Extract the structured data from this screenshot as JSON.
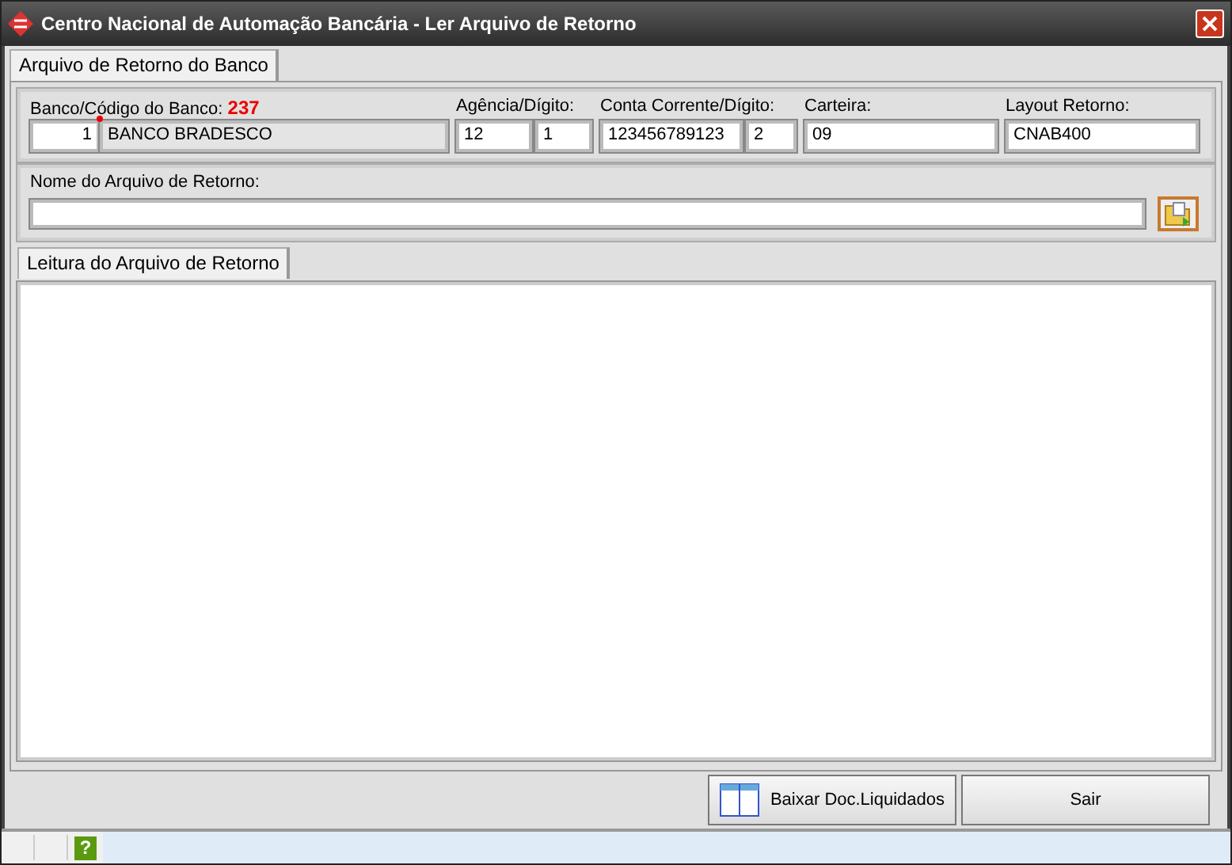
{
  "window": {
    "title": "Centro Nacional de Automação Bancária - Ler Arquivo de Retorno"
  },
  "tabs": [
    {
      "label": "Arquivo de Retorno do Banco",
      "selected": true
    }
  ],
  "bank": {
    "label": "Banco/Código do Banco:",
    "code_label": "237",
    "number": "1",
    "name": "BANCO BRADESCO",
    "required": true
  },
  "fields": [
    {
      "label": "Agência/Dígito:",
      "values": [
        "12",
        "1"
      ]
    },
    {
      "label": "Conta Corrente/Dígito:",
      "values": [
        "123456789123",
        "2"
      ]
    },
    {
      "label": "Carteira:",
      "values": [
        "09"
      ]
    },
    {
      "label": "Layout Retorno:",
      "values": [
        "CNAB400"
      ]
    }
  ],
  "file": {
    "label": "Nome do Arquivo de Retorno:"
  },
  "reading_tabs": [
    {
      "label": "Leitura do Arquivo de Retorno",
      "selected": true
    }
  ],
  "buttons": [
    {
      "label": "Baixar Doc.Liquidados",
      "kind": "icon"
    },
    {
      "label": "Sair",
      "kind": "plain"
    }
  ],
  "status_bar": {
    "help": "?"
  }
}
